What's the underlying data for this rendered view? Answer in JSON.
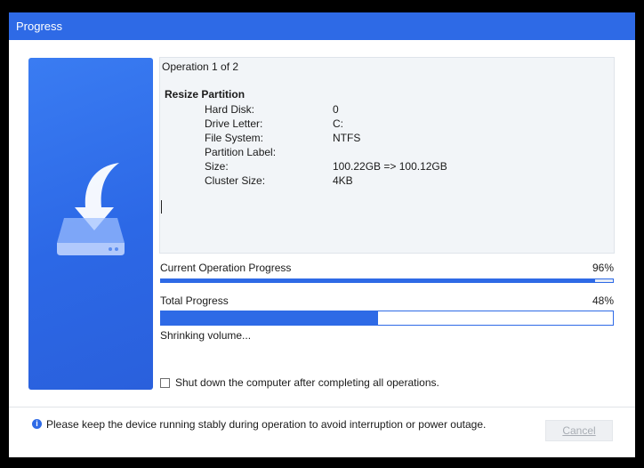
{
  "window": {
    "title": "Progress"
  },
  "details": {
    "operation_count": "Operation 1 of 2",
    "operation_name": "Resize Partition",
    "properties": [
      {
        "key": "Hard Disk:",
        "value": "0"
      },
      {
        "key": "Drive Letter:",
        "value": "C:"
      },
      {
        "key": "File System:",
        "value": "NTFS"
      },
      {
        "key": "Partition Label:",
        "value": ""
      },
      {
        "key": "Size:",
        "value": "100.22GB => 100.12GB"
      },
      {
        "key": "Cluster Size:",
        "value": "4KB"
      }
    ]
  },
  "progress": {
    "current_label": "Current Operation Progress",
    "current_pct_text": "96%",
    "current_value": 96,
    "total_label": "Total Progress",
    "total_pct_text": "48%",
    "total_value": 48,
    "status": "Shrinking volume..."
  },
  "shutdown": {
    "label": "Shut down the computer after completing all operations.",
    "checked": false
  },
  "footer": {
    "note": "Please keep the device running stably during operation to avoid interruption or power outage.",
    "cancel_label": "Cancel"
  },
  "colors": {
    "accent": "#2e6ae6"
  },
  "icons": {
    "illustration": "drive-download-icon",
    "info": "info-icon"
  }
}
